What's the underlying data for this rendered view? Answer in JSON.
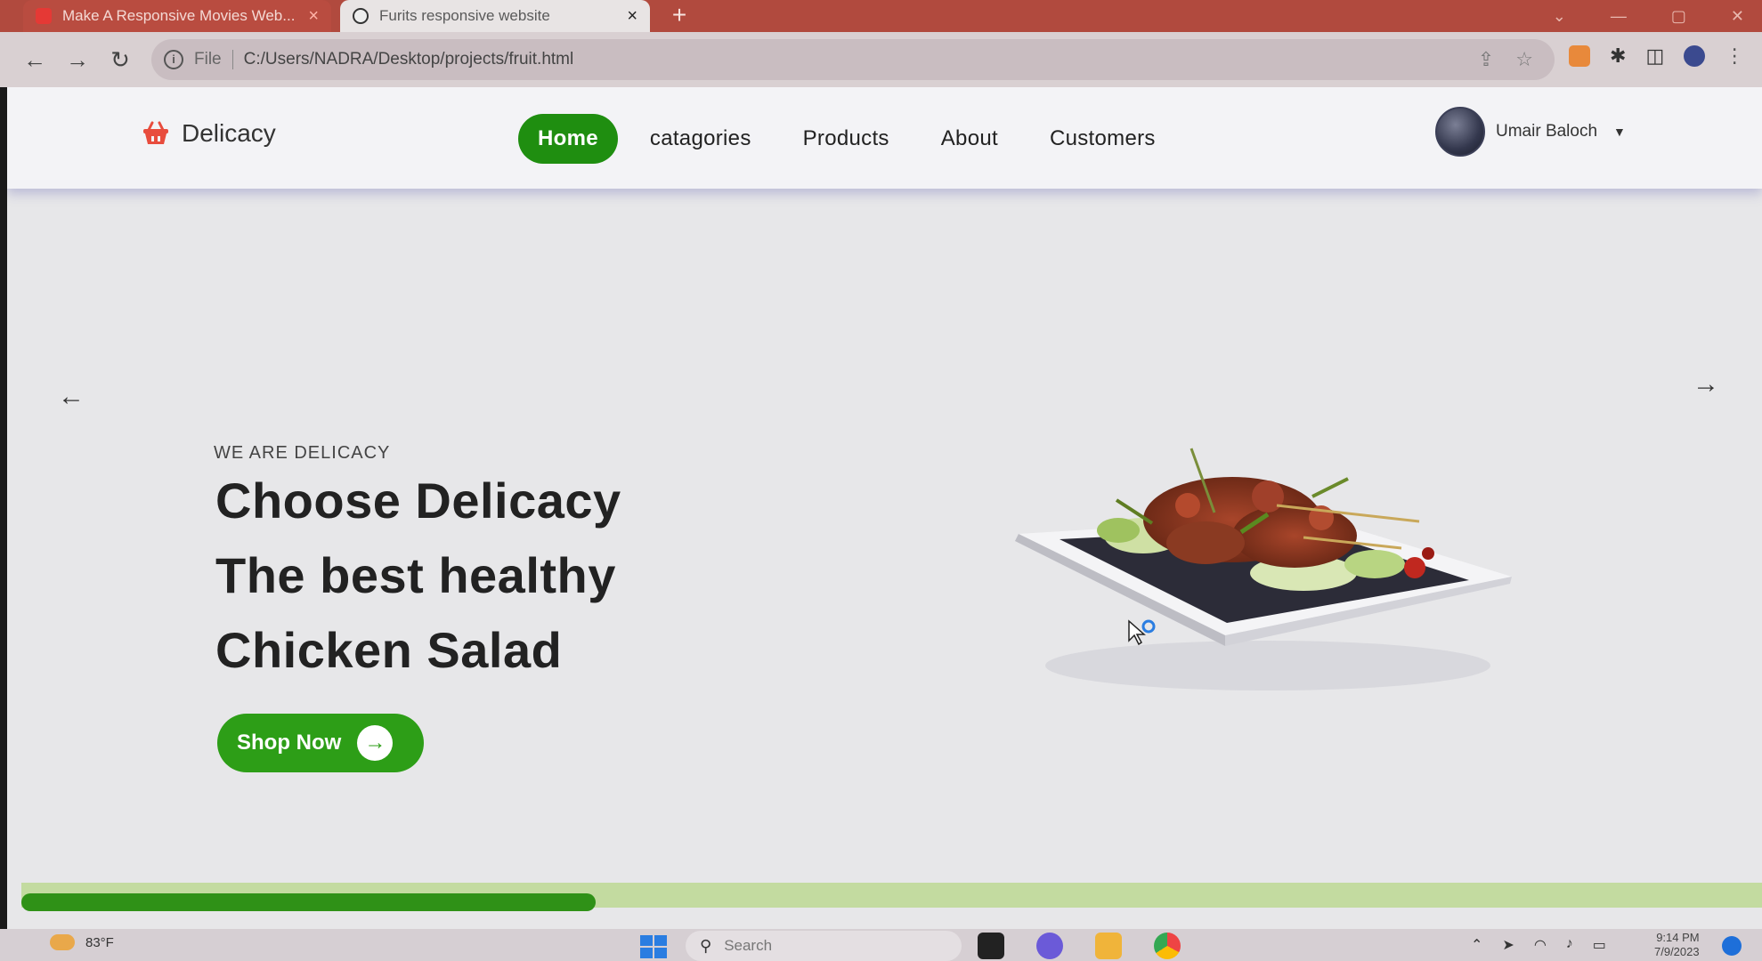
{
  "browser": {
    "tabs": [
      {
        "title": "Make A Responsive Movies Web...",
        "active": false
      },
      {
        "title": "Furits responsive website",
        "active": true
      }
    ],
    "new_tab_glyph": "+",
    "nav": {
      "back_glyph": "←",
      "forward_glyph": "→",
      "reload_glyph": "↻"
    },
    "address": {
      "scheme": "File",
      "url": "C:/Users/NADRA/Desktop/projects/fruit.html"
    },
    "window_controls": [
      "⌄",
      "—",
      "▢",
      "✕"
    ]
  },
  "site": {
    "brand": {
      "name": "Delicacy",
      "icon": "basket-icon",
      "accent": "#e84c3d"
    },
    "nav": [
      {
        "label": "Home",
        "active": true
      },
      {
        "label": "catagories",
        "active": false
      },
      {
        "label": "Products",
        "active": false
      },
      {
        "label": "About",
        "active": false
      },
      {
        "label": "Customers",
        "active": false
      }
    ],
    "user": {
      "name": "Umair Baloch",
      "caret": "▼"
    },
    "hero": {
      "eyebrow": "WE ARE DELICACY",
      "lines": [
        "Choose Delicacy",
        "The best healthy",
        "Chicken Salad"
      ],
      "cta_label": "Shop Now",
      "cta_arrow": "→",
      "prev_arrow": "←",
      "next_arrow": "→"
    },
    "slider_progress": 0.33,
    "colors": {
      "primary_green": "#2d9e17",
      "nav_active": "#1f8e10",
      "progress_track": "#c3dba0"
    }
  },
  "taskbar": {
    "weather": "83°F",
    "search_placeholder": "Search",
    "time": "9:14 PM",
    "date": "7/9/2023"
  }
}
